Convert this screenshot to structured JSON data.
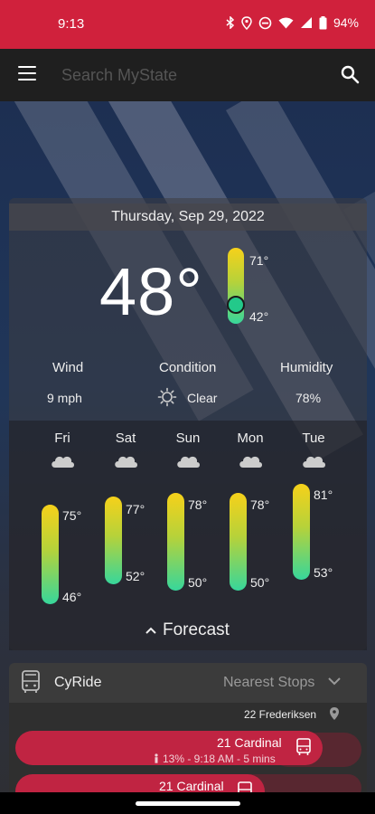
{
  "status_bar": {
    "time": "9:13",
    "battery": "94%",
    "icons": [
      "bluetooth-icon",
      "location-icon",
      "do-not-disturb-icon",
      "wifi-icon",
      "signal-icon",
      "battery-icon"
    ]
  },
  "app_bar": {
    "search_placeholder": "Search MyState",
    "icons": [
      "menu-icon",
      "search-icon"
    ]
  },
  "weather": {
    "date": "Thursday, Sep 29, 2022",
    "current_temp": "48°",
    "today_high": "71°",
    "today_low": "42°",
    "wind_label": "Wind",
    "wind_value": "9 mph",
    "condition_label": "Condition",
    "condition_value": "Clear",
    "condition_icon": "sun-icon",
    "humidity_label": "Humidity",
    "humidity_value": "78%",
    "forecast": [
      {
        "day": "Fri",
        "high": "75°",
        "low": "46°",
        "icon": "cloud-icon"
      },
      {
        "day": "Sat",
        "high": "77°",
        "low": "52°",
        "icon": "cloud-icon"
      },
      {
        "day": "Sun",
        "high": "78°",
        "low": "50°",
        "icon": "cloud-icon"
      },
      {
        "day": "Mon",
        "high": "78°",
        "low": "50°",
        "icon": "cloud-icon"
      },
      {
        "day": "Tue",
        "high": "81°",
        "low": "53°",
        "icon": "cloud-icon"
      }
    ],
    "forecast_toggle": "Forecast"
  },
  "cyride": {
    "title": "CyRide",
    "nearest_stops": "Nearest Stops",
    "stop_name": "22 Frederiksen",
    "routes": [
      {
        "name": "21 Cardinal",
        "detail": "13% - 9:18 AM - 5 mins"
      },
      {
        "name": "21 Cardinal",
        "detail": ""
      }
    ]
  },
  "colors": {
    "accent": "#d0213c",
    "route_card": "#c02442",
    "temp_hot": "#f6d11a",
    "temp_cold": "#37d69b"
  }
}
